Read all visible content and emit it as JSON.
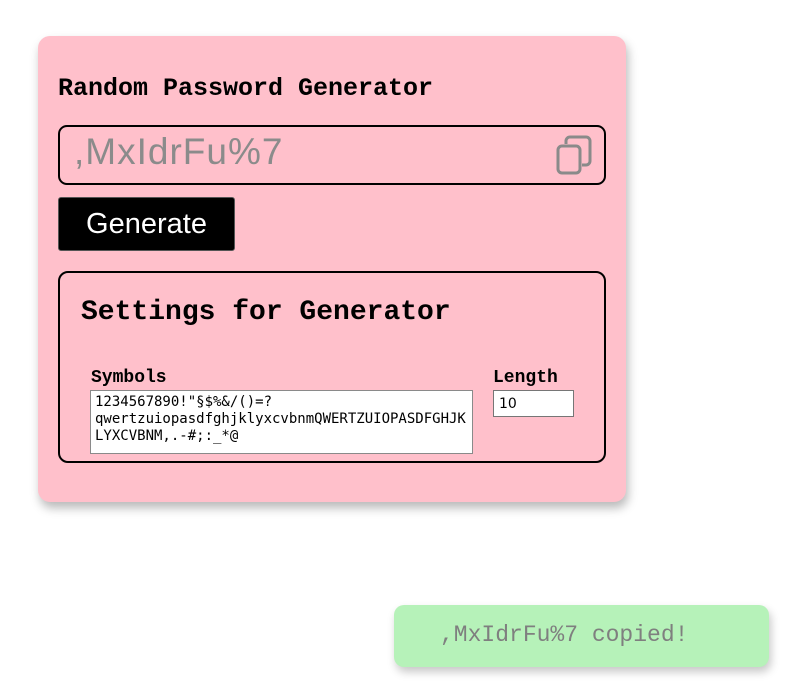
{
  "generator": {
    "title": "Random Password Generator",
    "password": ",MxIdrFu%7",
    "copy_icon": "copy-icon",
    "generate_label": "Generate"
  },
  "settings": {
    "title": "Settings for Generator",
    "symbols_label": "Symbols",
    "symbols_value": "1234567890!\"§$%&/()=?qwertzuiopasdfghjklyxcvbnmQWERTZUIOPASDFGHJKLYXCVBNM,.-#;:_*@",
    "length_label": "Length",
    "length_value": "10"
  },
  "toast": {
    "message": ",MxIdrFu%7 copied!"
  },
  "colors": {
    "card_background": "#ffc0cb",
    "toast_background": "#b6f2b9",
    "button_background": "#000000"
  }
}
